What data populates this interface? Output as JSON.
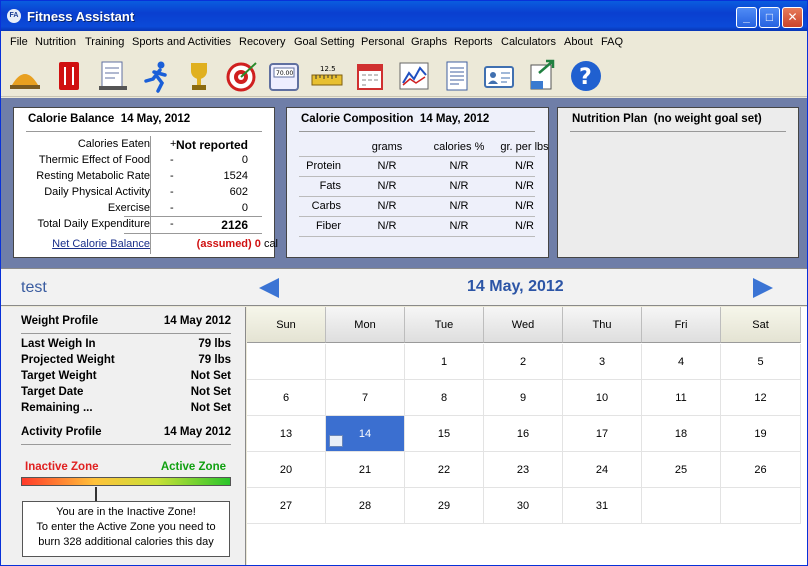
{
  "window": {
    "title": "Fitness Assistant",
    "app_icon_text": "FA"
  },
  "menu": [
    "File",
    "Nutrition",
    "Training",
    "Sports and Activities",
    "Recovery",
    "Goal Setting",
    "Personal",
    "Graphs",
    "Reports",
    "Calculators",
    "About",
    "FAQ"
  ],
  "toolbar_icons": [
    {
      "name": "food-dome-icon",
      "color": "#e8a020"
    },
    {
      "name": "menu-book-icon",
      "color": "#d01010"
    },
    {
      "name": "workout-log-icon",
      "color": "#6070a0"
    },
    {
      "name": "runner-icon",
      "color": "#1a5fd8"
    },
    {
      "name": "trophy-icon",
      "color": "#e0b020"
    },
    {
      "name": "target-icon",
      "color": "#d02020"
    },
    {
      "name": "scale-icon",
      "color": "#6070a0"
    },
    {
      "name": "tape-measure-icon",
      "color": "#e8c030"
    },
    {
      "name": "calendar-icon",
      "color": "#d03030"
    },
    {
      "name": "line-graph-icon",
      "color": "#2050c0"
    },
    {
      "name": "report-icon",
      "color": "#4060a0"
    },
    {
      "name": "profile-card-icon",
      "color": "#4070b0"
    },
    {
      "name": "export-icon",
      "color": "#208040"
    },
    {
      "name": "help-icon",
      "color": "#2060d0"
    }
  ],
  "calorie_balance": {
    "title": "Calorie Balance",
    "date": "14 May, 2012",
    "rows": [
      {
        "label": "Calories Eaten",
        "op": "+",
        "value": "Not reported"
      },
      {
        "label": "Thermic Effect of Food",
        "op": "-",
        "value": "0"
      },
      {
        "label": "Resting Metabolic Rate",
        "op": "-",
        "value": "1524"
      },
      {
        "label": "Daily Physical Activity",
        "op": "-",
        "value": "602"
      },
      {
        "label": "Exercise",
        "op": "-",
        "value": "0"
      },
      {
        "label": "Total Daily Expenditure",
        "op": "-",
        "value": "2126"
      }
    ],
    "net_label": "Net Calorie Balance",
    "net_assumed": "(assumed) 0",
    "net_unit": "cal"
  },
  "calorie_composition": {
    "title": "Calorie Composition",
    "date": "14 May, 2012",
    "headers": [
      "grams",
      "calories %",
      "gr. per lbs"
    ],
    "rows": [
      {
        "label": "Protein",
        "values": [
          "N/R",
          "N/R",
          "N/R"
        ]
      },
      {
        "label": "Fats",
        "values": [
          "N/R",
          "N/R",
          "N/R"
        ]
      },
      {
        "label": "Carbs",
        "values": [
          "N/R",
          "N/R",
          "N/R"
        ]
      },
      {
        "label": "Fiber",
        "values": [
          "N/R",
          "N/R",
          "N/R"
        ]
      }
    ]
  },
  "nutrition_plan": {
    "title": "Nutrition Plan",
    "note": "(no weight goal set)"
  },
  "date_bar": {
    "user": "test",
    "date": "14 May, 2012"
  },
  "weight_profile": {
    "title": "Weight Profile",
    "date": "14 May 2012",
    "rows": [
      {
        "label": "Last Weigh In",
        "value": "79 lbs"
      },
      {
        "label": "Projected Weight",
        "value": "79 lbs"
      },
      {
        "label": "Target Weight",
        "value": "Not Set"
      },
      {
        "label": "Target Date",
        "value": "Not Set"
      },
      {
        "label": "Remaining ...",
        "value": "Not Set"
      }
    ]
  },
  "activity_profile": {
    "title": "Activity Profile",
    "date": "14 May 2012",
    "inactive_label": "Inactive Zone",
    "active_label": "Active Zone",
    "inactive_color": "#e02020",
    "active_color": "#10a010",
    "message": [
      "You are in the Inactive Zone!",
      "To enter the Active Zone you need to",
      "burn 328 additional calories this day"
    ]
  },
  "calendar": {
    "days": [
      "Sun",
      "Mon",
      "Tue",
      "Wed",
      "Thu",
      "Fri",
      "Sat"
    ],
    "weeks": [
      [
        "",
        "",
        "1",
        "2",
        "3",
        "4",
        "5"
      ],
      [
        "6",
        "7",
        "8",
        "9",
        "10",
        "11",
        "12"
      ],
      [
        "13",
        "14",
        "15",
        "16",
        "17",
        "18",
        "19"
      ],
      [
        "20",
        "21",
        "22",
        "23",
        "24",
        "25",
        "26"
      ],
      [
        "27",
        "28",
        "29",
        "30",
        "31",
        "",
        ""
      ]
    ],
    "selected": "14"
  }
}
